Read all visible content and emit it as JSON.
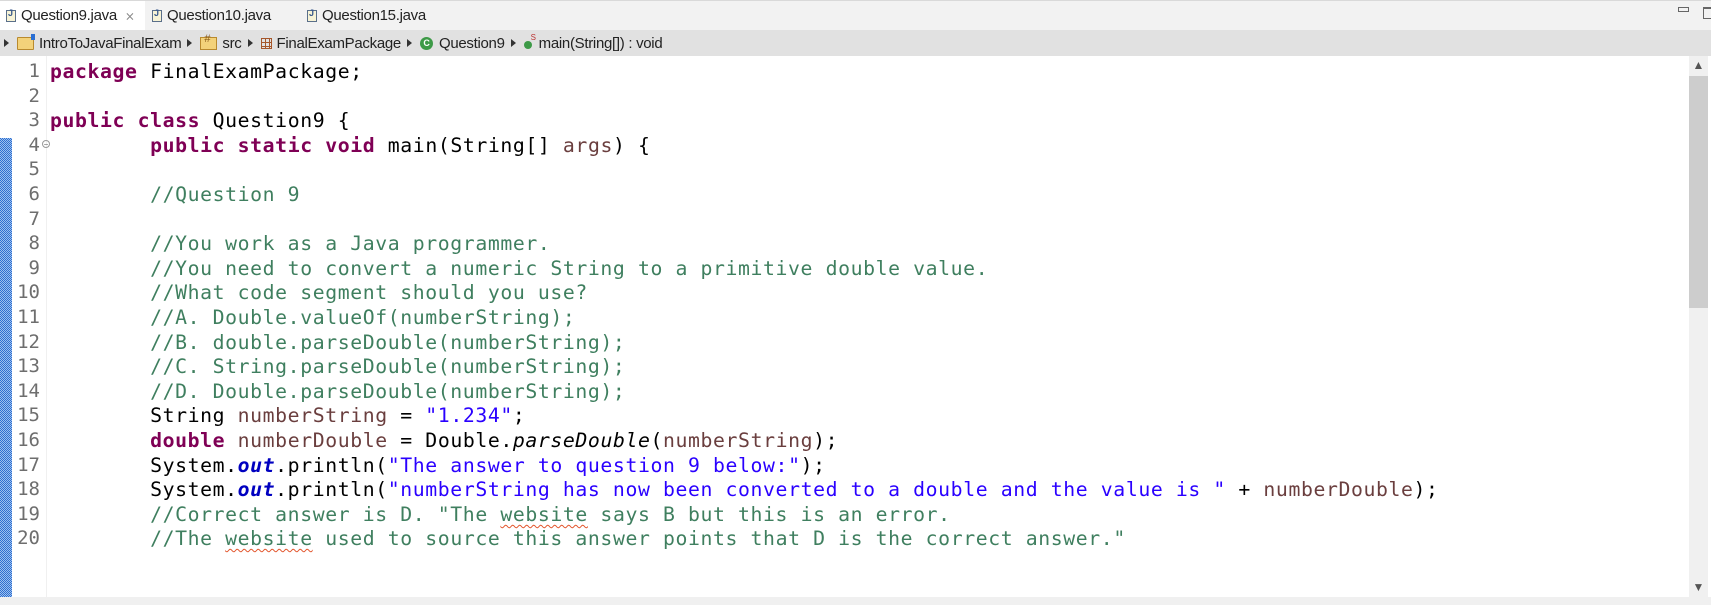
{
  "tabs": [
    {
      "label": "Question9.java",
      "active": true,
      "icon": "java-file-icon",
      "closable": true
    },
    {
      "label": "Question10.java",
      "active": false,
      "icon": "java-file-icon"
    },
    {
      "label": "Question15.java",
      "active": false,
      "icon": "java-file-icon"
    }
  ],
  "tab_close_glyph": "⨯",
  "breadcrumb": [
    {
      "label": "IntroToJavaFinalExam",
      "icon": "project-folder-icon"
    },
    {
      "label": "src",
      "icon": "source-folder-icon"
    },
    {
      "label": "FinalExamPackage",
      "icon": "package-icon"
    },
    {
      "label": "Question9",
      "icon": "class-icon"
    },
    {
      "label": "main(String[]) : void",
      "icon": "static-method-icon"
    }
  ],
  "window_controls": {
    "minimize": "minimize",
    "maximize": "maximize"
  },
  "editor": {
    "line_numbers": [
      "1",
      "2",
      "3",
      "4",
      "5",
      "6",
      "7",
      "8",
      "9",
      "10",
      "11",
      "12",
      "13",
      "14",
      "15",
      "16",
      "17",
      "18",
      "19",
      "20"
    ],
    "folded_line": "4",
    "lines": [
      [
        {
          "t": "package",
          "c": "kw"
        },
        {
          "t": " FinalExamPackage;"
        }
      ],
      [],
      [
        {
          "t": "public",
          "c": "kw"
        },
        {
          "t": " "
        },
        {
          "t": "class",
          "c": "kw"
        },
        {
          "t": " Question9 {"
        }
      ],
      [
        {
          "t": "        "
        },
        {
          "t": "public",
          "c": "kw"
        },
        {
          "t": " "
        },
        {
          "t": "static",
          "c": "kw"
        },
        {
          "t": " "
        },
        {
          "t": "void",
          "c": "kw"
        },
        {
          "t": " main(String[] "
        },
        {
          "t": "args",
          "c": "lv"
        },
        {
          "t": ") {"
        }
      ],
      [],
      [
        {
          "t": "        "
        },
        {
          "t": "//Question 9",
          "c": "cm"
        }
      ],
      [],
      [
        {
          "t": "        "
        },
        {
          "t": "//You work as a Java programmer.",
          "c": "cm"
        }
      ],
      [
        {
          "t": "        "
        },
        {
          "t": "//You need to convert a numeric String to a primitive double value.",
          "c": "cm"
        }
      ],
      [
        {
          "t": "        "
        },
        {
          "t": "//What code segment should you use?",
          "c": "cm"
        }
      ],
      [
        {
          "t": "        "
        },
        {
          "t": "//A. Double.valueOf(numberString);",
          "c": "cm"
        }
      ],
      [
        {
          "t": "        "
        },
        {
          "t": "//B. double.parseDouble(numberString);",
          "c": "cm"
        }
      ],
      [
        {
          "t": "        "
        },
        {
          "t": "//C. String.parseDouble(numberString);",
          "c": "cm"
        }
      ],
      [
        {
          "t": "        "
        },
        {
          "t": "//D. Double.parseDouble(numberString);",
          "c": "cm"
        }
      ],
      [
        {
          "t": "        String "
        },
        {
          "t": "numberString",
          "c": "lv"
        },
        {
          "t": " = "
        },
        {
          "t": "\"1.234\"",
          "c": "st"
        },
        {
          "t": ";"
        }
      ],
      [
        {
          "t": "        "
        },
        {
          "t": "double",
          "c": "kw"
        },
        {
          "t": " "
        },
        {
          "t": "numberDouble",
          "c": "lv"
        },
        {
          "t": " = Double."
        },
        {
          "t": "parseDouble",
          "c": "it"
        },
        {
          "t": "("
        },
        {
          "t": "numberString",
          "c": "lv"
        },
        {
          "t": ");"
        }
      ],
      [
        {
          "t": "        System."
        },
        {
          "t": "out",
          "c": "sf"
        },
        {
          "t": ".println("
        },
        {
          "t": "\"The answer to question 9 below:\"",
          "c": "st"
        },
        {
          "t": ");"
        }
      ],
      [
        {
          "t": "        System."
        },
        {
          "t": "out",
          "c": "sf"
        },
        {
          "t": ".println("
        },
        {
          "t": "\"numberString has now been converted to a double and the value is \"",
          "c": "st"
        },
        {
          "t": " + "
        },
        {
          "t": "numberDouble",
          "c": "lv"
        },
        {
          "t": ");"
        }
      ],
      [
        {
          "t": "        "
        },
        {
          "t": "//Correct answer is D. \"The ",
          "c": "cm"
        },
        {
          "t": "website",
          "c": "cm squig"
        },
        {
          "t": " says B but this is an error.",
          "c": "cm"
        }
      ],
      [
        {
          "t": "        "
        },
        {
          "t": "//The ",
          "c": "cm"
        },
        {
          "t": "website",
          "c": "cm squig"
        },
        {
          "t": " used to source this answer points that D is the correct answer.\"",
          "c": "cm"
        }
      ]
    ]
  },
  "scrollbar": {
    "up": "▲",
    "down": "▼",
    "position": 0.0,
    "visible_fraction": 0.45
  },
  "colors": {
    "keyword": "#7f0055",
    "comment": "#3f7f5f",
    "string": "#2a00ff",
    "local_variable": "#6a3e3e",
    "static_field": "#0000c0"
  }
}
